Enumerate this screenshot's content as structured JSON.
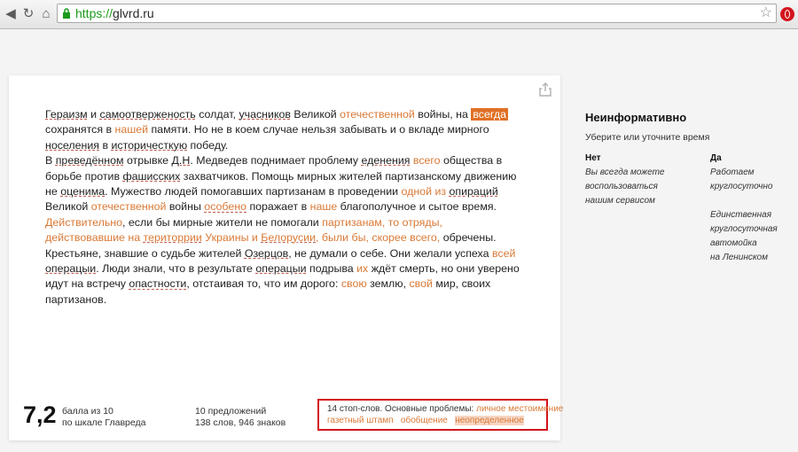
{
  "browser": {
    "url_scheme": "https://",
    "url_host": "glvrd.ru"
  },
  "text": {
    "p1": {
      "s1": "Гераизм",
      "s2": " и ",
      "s3": "самоотверженость",
      "s4": " солдат, ",
      "s5": "учасников",
      "s6": " Великой ",
      "s7": "отечественной",
      "s8": " войны, на ",
      "s9": "всегда",
      "s10": " сохранятся в ",
      "s11": "нашей",
      "s12": " памяти. Но не в коем случае нельзя забывать и о вкладе мирного ",
      "s13": "носеления",
      "s14": " в ",
      "s15": "историчесткую",
      "s16": " победу."
    },
    "p2": {
      "s1": "В ",
      "s2": "преведённом",
      "s3": " отрывке ",
      "s4": "Д.Н",
      "s5": ". Медведев поднимает проблему ",
      "s6": "еденения",
      "s7": " ",
      "s8": "всего",
      "s9": " общества в борьбе против ",
      "s10": "фашисских",
      "s11": " захватчиков. Помощь мирных жителей партизанскому движению не ",
      "s12": "оценима",
      "s13": ". Мужество людей помогавших партизанам в проведении ",
      "s14": "одной из",
      "s15": " ",
      "s16": "опираций",
      "s17": " Великой ",
      "s18": "отечественной",
      "s19": " войны  ",
      "s20": "особено",
      "s21": " поражает в ",
      "s22": "наше",
      "s23": " благополучное и сытое время. ",
      "s24": "Действительно",
      "s25": ", если бы мирные жители не помогали ",
      "s26": "партизанам, то отряды, действовавшие на ",
      "s27": "територрии",
      "s28": " Украины и  ",
      "s29": "Белорусии",
      "s30": ", были бы, скорее всего,",
      "s31": " обречены. Крестьяне, знавшие о судьбе жителей ",
      "s32": "Озерцов",
      "s33": ", не думали о себе. Они желали успеха ",
      "s34": "всей",
      "s35": " ",
      "s36": "операцыи",
      "s37": ". Люди знали, что в результате ",
      "s38": "операцыи",
      "s39": " подрыва ",
      "s40": "их",
      "s41": " ждёт смерть, но они уверено идут на встречу ",
      "s42": "опастности",
      "s43": ", отстаивая то, что им дорого: ",
      "s44": "свою",
      "s45": " землю, ",
      "s46": "свой",
      "s47": " мир, своих партизанов."
    }
  },
  "score": {
    "value": "7,2",
    "line1": "балла из 10",
    "line2": "по шкале Главреда"
  },
  "stats": {
    "line1": "10 предложений",
    "line2": "138 слов, 946 знаков"
  },
  "problems": {
    "prefix": "14 стоп-слов. Основные проблемы: ",
    "t1": "личное местоимение",
    "t2": "газетный штамп",
    "t3": "обобщение",
    "t4": "неопределенное"
  },
  "side": {
    "title": "Неинформативно",
    "subtitle": "Уберите или уточните время",
    "no_header": "Нет",
    "no_items": [
      "Вы всегда можете",
      "воспользоваться",
      "нашим сервисом"
    ],
    "yes_header": "Да",
    "yes_items_a": [
      "Работаем",
      "круглосуточно"
    ],
    "yes_items_b": [
      "Единственная",
      "круглосуточная",
      "автомойка",
      "на Ленинском"
    ]
  }
}
